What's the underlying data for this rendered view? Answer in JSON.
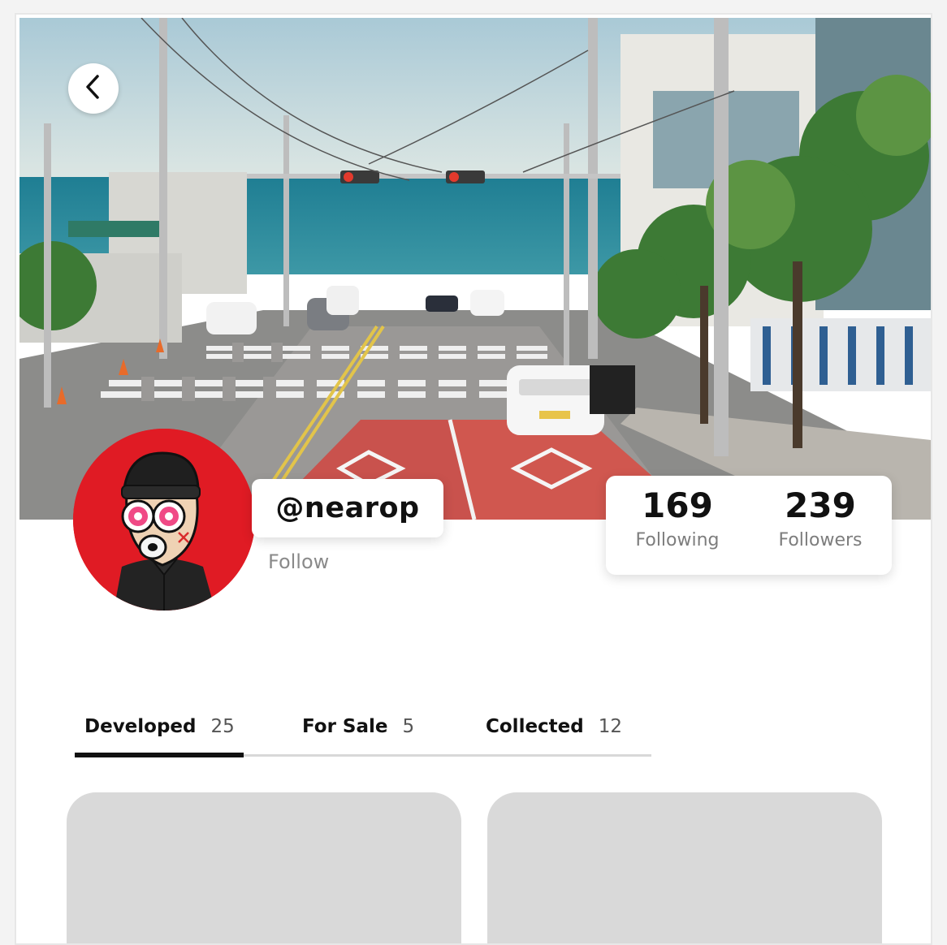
{
  "profile": {
    "handle": "@nearop",
    "follow_label": "Follow"
  },
  "stats": {
    "following_count": "169",
    "following_label": "Following",
    "followers_count": "239",
    "followers_label": "Followers"
  },
  "tabs": [
    {
      "label": "Developed",
      "count": "25",
      "active": true
    },
    {
      "label": "For Sale",
      "count": "5",
      "active": false
    },
    {
      "label": "Collected",
      "count": "12",
      "active": false
    }
  ],
  "icons": {
    "back": "chevron-left-icon"
  },
  "colors": {
    "avatar_background": "#e01b24",
    "card_placeholder": "#d9d9d9",
    "active_tab_underline": "#111111"
  }
}
